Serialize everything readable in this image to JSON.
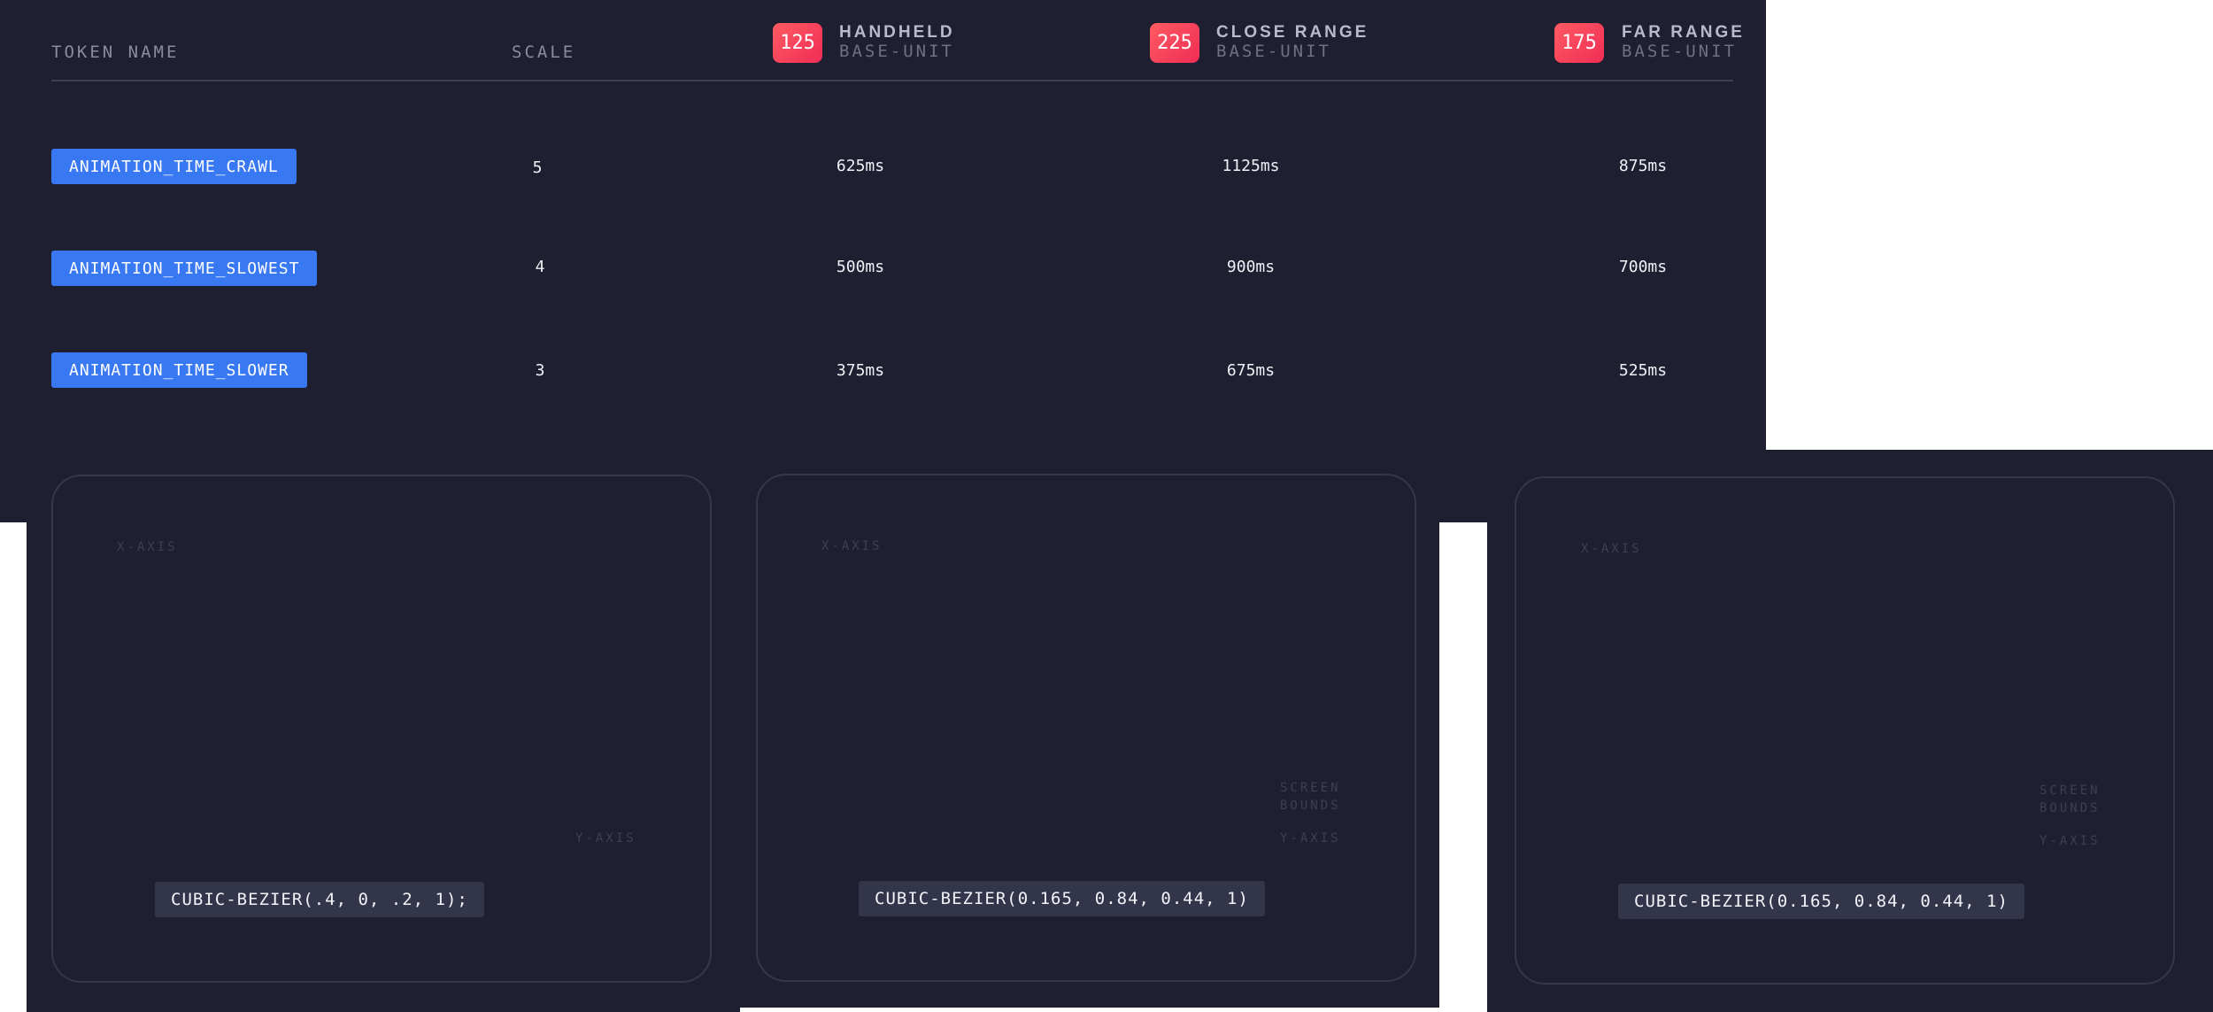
{
  "table": {
    "headers": {
      "token_name": "TOKEN NAME",
      "scale": "SCALE"
    },
    "devices": [
      {
        "base": "125",
        "name": "HANDHELD",
        "sub": "BASE-UNIT"
      },
      {
        "base": "225",
        "name": "CLOSE RANGE",
        "sub": "BASE-UNIT"
      },
      {
        "base": "175",
        "name": "FAR RANGE",
        "sub": "BASE-UNIT"
      }
    ],
    "rows": [
      {
        "token": "ANIMATION_TIME_CRAWL",
        "scale": "5",
        "handheld": "625ms",
        "close_range": "1125ms",
        "far_range": "875ms"
      },
      {
        "token": "ANIMATION_TIME_SLOWEST",
        "scale": "4",
        "handheld": "500ms",
        "close_range": "900ms",
        "far_range": "700ms"
      },
      {
        "token": "ANIMATION_TIME_SLOWER",
        "scale": "3",
        "handheld": "375ms",
        "close_range": "675ms",
        "far_range": "525ms"
      }
    ]
  },
  "curves": [
    {
      "x_axis": "X-AXIS",
      "y_axis": "Y-AXIS",
      "bounds": "",
      "code": "CUBIC-BEZIER(.4, 0, .2, 1);"
    },
    {
      "x_axis": "X-AXIS",
      "y_axis": "Y-AXIS",
      "bounds": "SCREEN BOUNDS",
      "bounds_l1": "SCREEN",
      "bounds_l2": "BOUNDS",
      "code": "CUBIC-BEZIER(0.165, 0.84, 0.44, 1)"
    },
    {
      "x_axis": "X-AXIS",
      "y_axis": "Y-AXIS",
      "bounds": "SCREEN BOUNDS",
      "bounds_l1": "SCREEN",
      "bounds_l2": "BOUNDS",
      "code": "CUBIC-BEZIER(0.165, 0.84, 0.44, 1)"
    }
  ],
  "colors": {
    "background": "#1e1f31",
    "token": "#3878f2",
    "curve": "#e8134f",
    "badge": "#f02d55",
    "axis": "#3d4052"
  }
}
